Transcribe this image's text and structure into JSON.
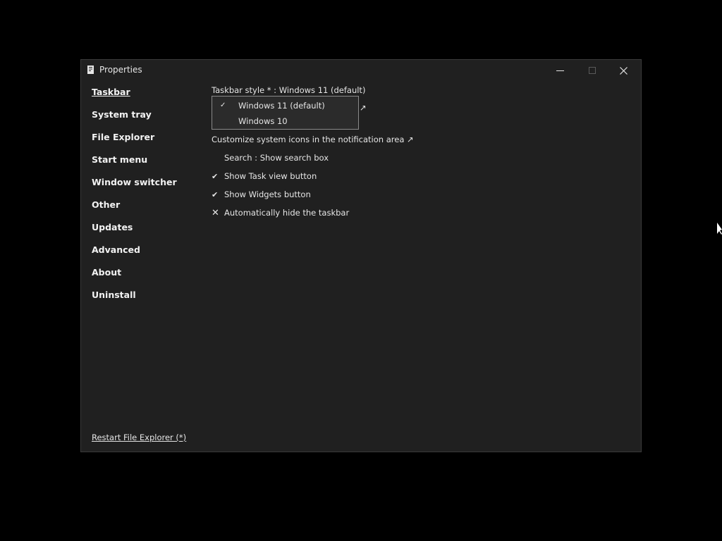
{
  "window": {
    "title": "Properties",
    "icon": "app-document-icon",
    "controls": {
      "minimize": "minimize-icon",
      "maximize": "maximize-icon",
      "close": "close-icon"
    }
  },
  "sidebar": {
    "items": [
      {
        "label": "Taskbar",
        "active": true
      },
      {
        "label": "System tray",
        "active": false
      },
      {
        "label": "File Explorer",
        "active": false
      },
      {
        "label": "Start menu",
        "active": false
      },
      {
        "label": "Window switcher",
        "active": false
      },
      {
        "label": "Other",
        "active": false
      },
      {
        "label": "Updates",
        "active": false
      },
      {
        "label": "Advanced",
        "active": false
      },
      {
        "label": "About",
        "active": false
      },
      {
        "label": "Uninstall",
        "active": false
      }
    ],
    "restart_link": "Restart File Explorer (*)"
  },
  "content": {
    "taskbar_style": "Taskbar style * : Windows 11 (default)",
    "hidden_row_tail": "↗",
    "customize_icons": "Customize system icons in the notification area ↗",
    "search_option": "Search : Show search box",
    "options": [
      {
        "label": "Show Task view button",
        "state": "checked",
        "mark": "✔"
      },
      {
        "label": "Show Widgets button",
        "state": "checked",
        "mark": "✔"
      },
      {
        "label": "Automatically hide the taskbar",
        "state": "unchecked",
        "mark": "✕"
      }
    ]
  },
  "dropdown": {
    "options": [
      {
        "label": "Windows 11 (default)",
        "selected": true,
        "mark": "✓"
      },
      {
        "label": "Windows 10",
        "selected": false,
        "mark": ""
      }
    ]
  },
  "colors": {
    "desktop": "#000000",
    "window_bg": "#202020",
    "text": "#e6e6e6",
    "dropdown_bg": "#2b2b2b",
    "dropdown_border": "#8a8a8a"
  }
}
